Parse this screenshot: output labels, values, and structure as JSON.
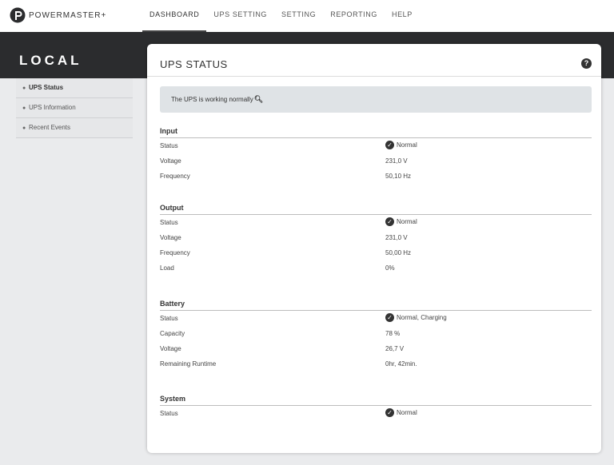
{
  "brand": {
    "name": "POWERMASTER+",
    "icon": "powermaster-logo"
  },
  "nav": [
    "DASHBOARD",
    "UPS SETTING",
    "SETTING",
    "REPORTING",
    "HELP"
  ],
  "sidebar": {
    "title": "LOCAL",
    "items": [
      "UPS Status",
      "UPS Information",
      "Recent Events"
    ],
    "active": "UPS Status"
  },
  "panel": {
    "title": "UPS STATUS",
    "help_icon": "help-icon",
    "banner": "The UPS is working normally"
  },
  "sections": {
    "input": {
      "title": "Input",
      "status_label": "Status",
      "status_value": "Normal",
      "voltage_label": "Voltage",
      "voltage_value": "231,0 V",
      "frequency_label": "Frequency",
      "frequency_value": "50,10 Hz"
    },
    "output": {
      "title": "Output",
      "status_label": "Status",
      "status_value": "Normal",
      "voltage_label": "Voltage",
      "voltage_value": "231,0 V",
      "frequency_label": "Frequency",
      "frequency_value": "50,00 Hz",
      "load_label": "Load",
      "load_value": "0%"
    },
    "battery": {
      "title": "Battery",
      "status_label": "Status",
      "status_value": "Normal, Charging",
      "capacity_label": "Capacity",
      "capacity_value": "78 %",
      "voltage_label": "Voltage",
      "voltage_value": "26,7 V",
      "runtime_label": "Remaining Runtime",
      "runtime_value": "0hr, 42min."
    },
    "system": {
      "title": "System",
      "status_label": "Status",
      "status_value": "Normal"
    }
  },
  "colors": {
    "dark_band": "#2b2c2e",
    "page_bg": "#eaebed",
    "banner_bg": "#dfe3e6",
    "accent": "#333333"
  }
}
